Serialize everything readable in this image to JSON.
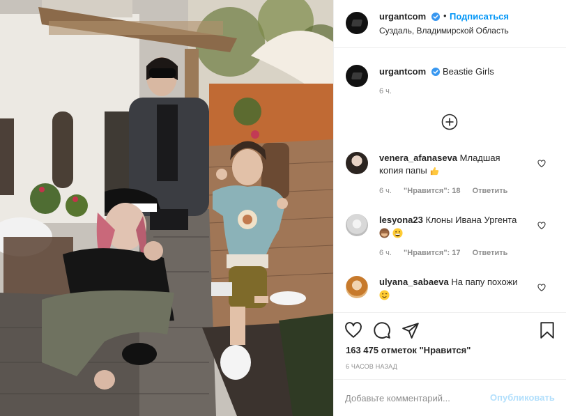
{
  "header": {
    "username": "urgantcom",
    "separator": "•",
    "follow_label": "Подписаться",
    "location": "Суздаль, Владимирской Область",
    "avatar_icon": "profile-avatar",
    "verified_icon": "verified-badge-icon"
  },
  "caption": {
    "username": "urgantcom",
    "text": "Beastie Girls",
    "time": "6 ч."
  },
  "load_more_icon": "plus-circle-icon",
  "comments": [
    {
      "username": "venera_afanaseva",
      "text_line1": "Младшая",
      "text_line2": "копия папы",
      "emoji": "thumbs-up",
      "time": "6 ч.",
      "likes": "\"Нравится\": 18",
      "reply": "Ответить"
    },
    {
      "username": "lesyona23",
      "text_line1": "Клоны Ивана Ургента",
      "emoji": "see-no-evil-monkey, grinning-face",
      "time": "6 ч.",
      "likes": "\"Нравится\": 17",
      "reply": "Ответить"
    },
    {
      "username": "ulyana_sabaeva",
      "text_line1": "На папу похожи",
      "emoji": "winking-face"
    }
  ],
  "actions": {
    "icons": [
      "heart-icon",
      "comment-icon",
      "share-icon",
      "bookmark-icon"
    ],
    "likes_text": "163 475 отметок \"Нравится\"",
    "time_ago": "6 ЧАСОВ НАЗАД"
  },
  "add_comment": {
    "placeholder": "Добавьте комментарий...",
    "publish_label": "Опубликовать"
  },
  "colors": {
    "accent": "#0095f6",
    "publish_disabled": "#b2dffc",
    "muted": "#8e8e8e",
    "text": "#262626",
    "border": "#efefef"
  }
}
